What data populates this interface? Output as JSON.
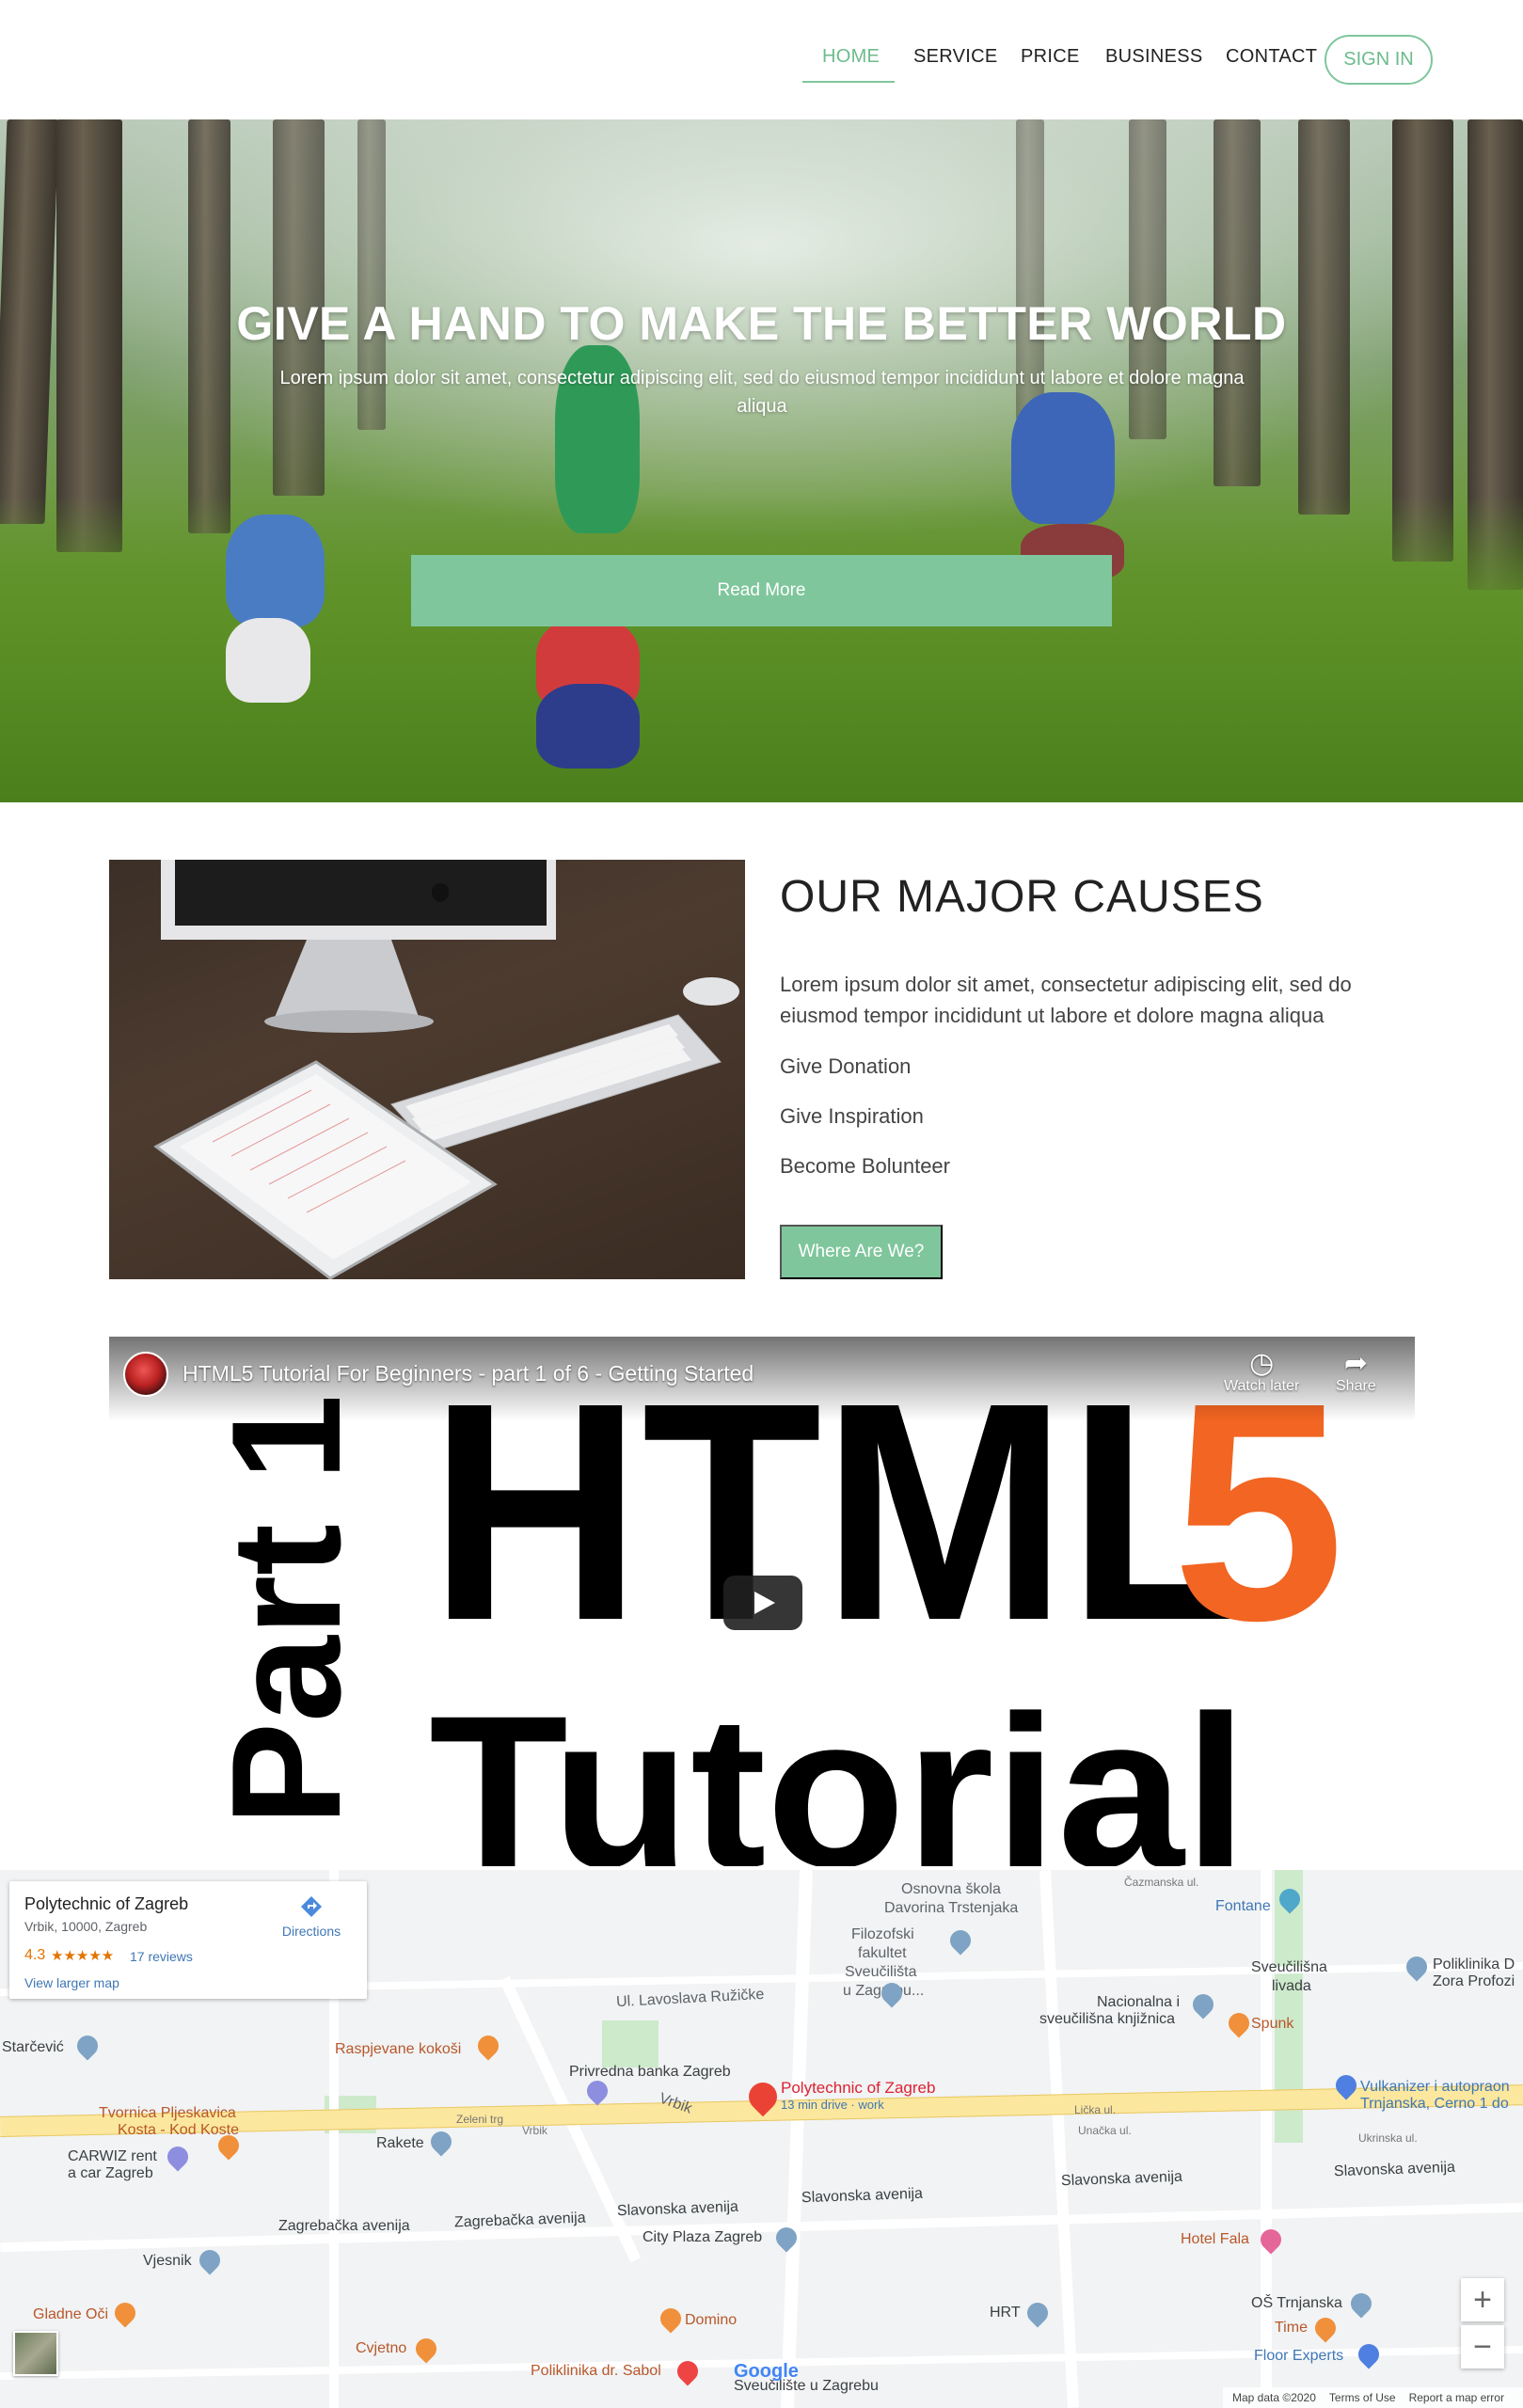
{
  "nav": {
    "items": [
      "HOME",
      "SERVICE",
      "PRICE",
      "BUSINESS",
      "CONTACT"
    ],
    "signin": "SIGN IN",
    "accent": "#7fc69c"
  },
  "hero": {
    "title": "GIVE A HAND TO MAKE THE BETTER WORLD",
    "subtitle": "Lorem ipsum dolor sit amet, consectetur adipiscing elit, sed do eiusmod tempor incididunt ut labore et dolore magna aliqua",
    "button": "Read More"
  },
  "causes": {
    "title": "OUR MAJOR CAUSES",
    "text": "Lorem ipsum dolor sit amet, consectetur adipiscing elit, sed do eiusmod tempor incididunt ut labore et dolore magna aliqua",
    "items": [
      "Give Donation",
      "Give Inspiration",
      "Become Bolunteer"
    ],
    "button": "Where Are We?"
  },
  "video": {
    "title": "HTML5 Tutorial For Beginners - part 1 of 6 - Getting Started",
    "watch_later": "Watch later",
    "share": "Share",
    "thumb_part": "Part 1",
    "thumb_html": "HTML",
    "thumb_five": "5",
    "thumb_tutorial": "Tutorial"
  },
  "map": {
    "place_name": "Polytechnic of Zagreb",
    "address": "Vrbik, 10000, Zagreb",
    "rating": "4.3",
    "stars": "★★★★★",
    "reviews": "17 reviews",
    "directions": "Directions",
    "larger_map": "View larger map",
    "pin_label": "Polytechnic of Zagreb",
    "pin_sub": "13 min drive · work",
    "footer_data": "Map data ©2020",
    "footer_terms": "Terms of Use",
    "footer_report": "Report a map error",
    "zoom_in": "+",
    "zoom_out": "−",
    "google": "Google",
    "labels": {
      "osnovna": "Osnovna škola",
      "davorina": "Davorina Trstenjaka",
      "filozofski": "Filozofski",
      "fakultet": "fakultet",
      "sveucilista": "Sveučilišta",
      "uzagrebu": "u Zagrebu...",
      "fontane": "Fontane",
      "sveucilisna": "Sveučilišna",
      "livada": "livada",
      "poliklinika_d": "Poliklinika D",
      "zora": "Zora Profozi",
      "nacionalna": "Nacionalna i",
      "knjiznica": "sveučilišna knjižnica",
      "spunk": "Spunk",
      "lavoslava": "Ul. Lavoslava Ružičke",
      "starcevic": "Starčević",
      "raspjevane": "Raspjevane kokoši",
      "privredna": "Privredna banka Zagreb",
      "vulkanizer": "Vulkanizer i autopraon",
      "trnjanska_c": "Trnjanska, Cerno 1 do",
      "tvornica": "Tvornica Pljeskavica",
      "kosta": "Kosta - Kod Koste",
      "carwiz": "CARWIZ rent",
      "acar": "a car Zagreb",
      "rakete": "Rakete",
      "zeleni_trg": "Zeleni trg",
      "vrbik": "Vrbik",
      "slavonska": "Slavonska avenija",
      "zagrebacka": "Zagrebačka avenija",
      "city_plaza": "City Plaza Zagreb",
      "hotel_fala": "Hotel Fala",
      "jesnik": "Vjesnik",
      "gladne": "Gladne Oči",
      "domino": "Domino",
      "hrt": "HRT",
      "os_trnjanska": "OŠ Trnjanska",
      "time": "Time",
      "floor": "Floor Experts",
      "cvjetno": "Cvjetno",
      "poliklinika_sabol": "Poliklinika dr. Sabol",
      "sveuciliste": "Sveučilište u Zagrebu",
      "licka": "Lička ul.",
      "unacka": "Unačka ul.",
      "ukrinska": "Ukrinska ul.",
      "cazmanska": "Čazmanska ul."
    }
  }
}
